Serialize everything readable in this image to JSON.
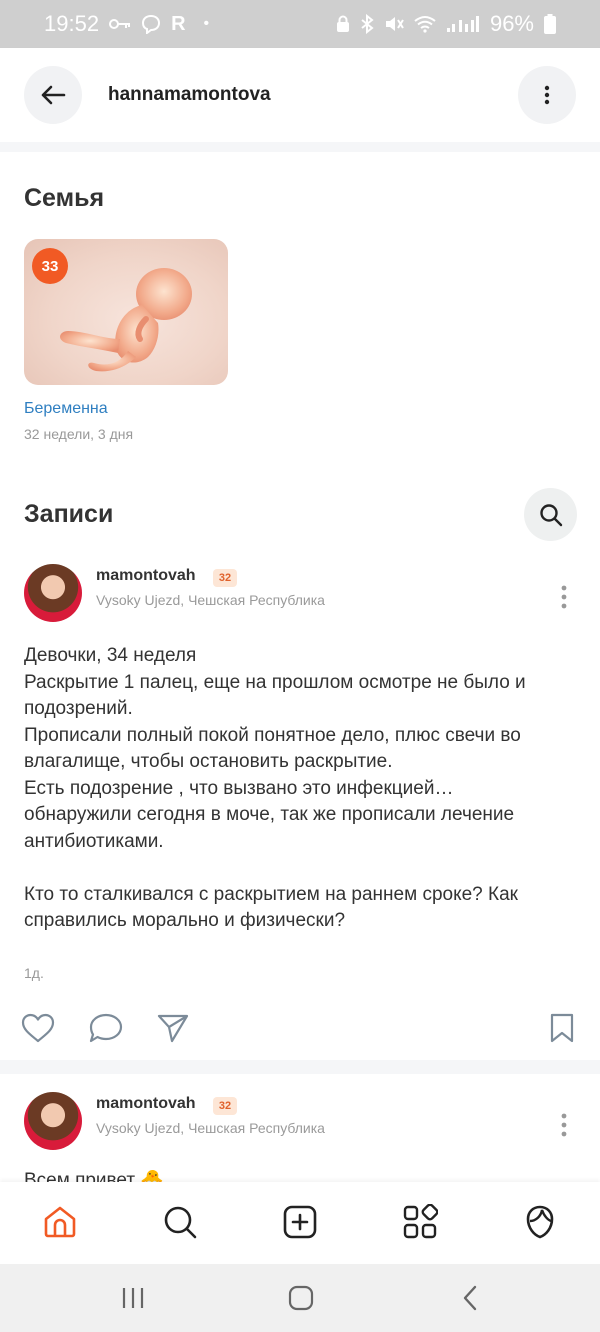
{
  "status_bar": {
    "time": "19:52",
    "left_icons": [
      "key-icon",
      "viber-icon"
    ],
    "carrier_letter": "R",
    "dot": "•",
    "right_icons": [
      "lock-icon",
      "bluetooth-icon",
      "mute-icon",
      "wifi-icon",
      "signal-icon"
    ],
    "battery": "96%"
  },
  "header": {
    "username": "hannamamontova",
    "back_icon": "arrow-left-icon",
    "more_icon": "more-vertical-icon"
  },
  "family": {
    "title": "Семья",
    "week_badge": "33",
    "status": "Беременна",
    "duration": "32 недели, 3 дня"
  },
  "posts_section": {
    "title": "Записи",
    "search_icon": "search-icon"
  },
  "posts": [
    {
      "author": "mamontovah",
      "badge": "32",
      "location": "Vysoky Ujezd, Чешская Республика",
      "lines": [
        "Девочки, 34 неделя",
        "Раскрытие 1 палец, еще на прошлом осмотре не было и",
        "подозрений.",
        "Прописали полный покой понятное дело, плюс свечи во",
        "влагалище, чтобы остановить раскрытие.",
        "Есть подозрение , что вызвано это инфекцией…",
        "обнаружили сегодня в моче, так же прописали лечение",
        "антибиотиками.",
        "",
        "Кто то сталкивался с раскрытием на раннем сроке? Как",
        "справились морально и физически?"
      ],
      "time": "1д."
    },
    {
      "author": "mamontovah",
      "badge": "32",
      "location": "Vysoky Ujezd, Чешская Республика",
      "preview": "Всем привет 🐣"
    }
  ],
  "bottom_nav": {
    "items": [
      "home-icon",
      "search-icon",
      "add-icon",
      "apps-icon",
      "profile-icon"
    ],
    "active_color": "#f15a24"
  },
  "system_nav": [
    "recent-apps-icon",
    "home-button-icon",
    "back-icon"
  ]
}
